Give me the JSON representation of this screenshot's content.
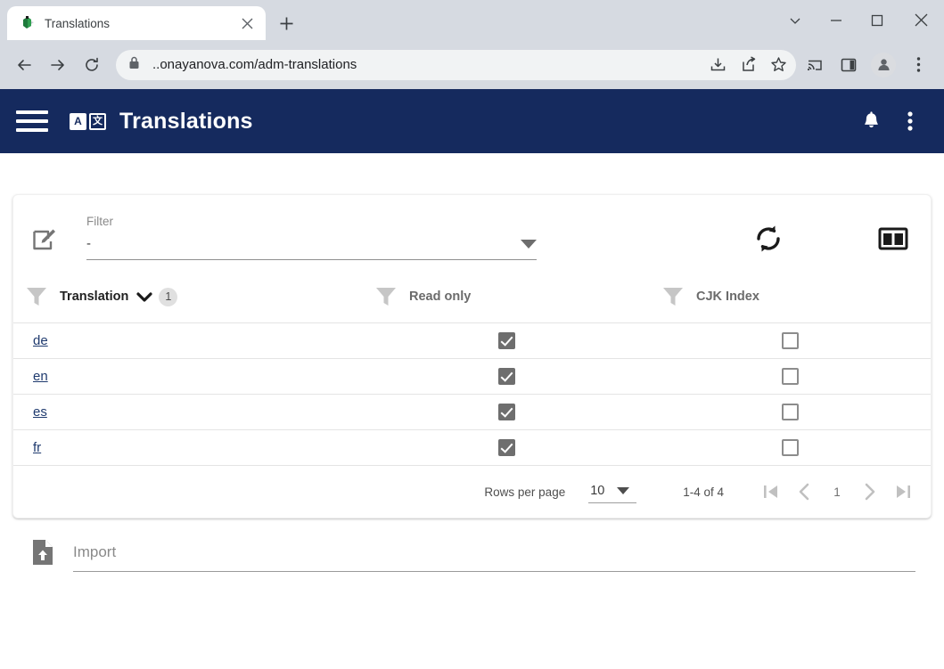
{
  "browser": {
    "tab": {
      "title": "Translations",
      "favicon_name": "site-favicon",
      "close_label": "×",
      "new_tab_label": "+"
    },
    "window_controls": {
      "tab_search": "tab-search-chevron",
      "minimize": "minimize",
      "maximize": "maximize",
      "close": "close"
    },
    "toolbar": {
      "back": "back-arrow",
      "forward": "forward-arrow",
      "reload": "reload",
      "lock": "lock-icon",
      "url": "..onayanova.com/adm-translations",
      "download": "download-icon",
      "share": "share-icon",
      "bookmark": "bookmark-star-icon",
      "cast": "cast-icon",
      "side_panel": "side-panel-icon",
      "profile": "profile-avatar",
      "menu": "browser-menu"
    }
  },
  "app_bar": {
    "menu_label": "menu",
    "logo_a": "A",
    "logo_cjk": "文",
    "title": "Translations",
    "notifications_label": "notifications",
    "overflow_label": "more-options",
    "background_color": "#152a5e"
  },
  "card": {
    "edit_icon": "edit-square-icon",
    "filter": {
      "label": "Filter",
      "value": "-",
      "placeholder": "-"
    },
    "actions": {
      "refresh": "refresh-icon",
      "columns": "columns-icon"
    },
    "table": {
      "columns": [
        {
          "label": "Translation",
          "active": true,
          "sort": "desc",
          "sort_order": "1"
        },
        {
          "label": "Read only",
          "active": false
        },
        {
          "label": "CJK Index",
          "active": false
        }
      ],
      "rows": [
        {
          "translation": "de",
          "read_only": true,
          "cjk_index": false
        },
        {
          "translation": "en",
          "read_only": true,
          "cjk_index": false
        },
        {
          "translation": "es",
          "read_only": true,
          "cjk_index": false
        },
        {
          "translation": "fr",
          "read_only": true,
          "cjk_index": false
        }
      ]
    },
    "paginator": {
      "rows_per_page_label": "Rows per page",
      "rows_per_page_value": "10",
      "range_label": "1-4 of 4",
      "page_number": "1",
      "first_label": "first-page",
      "prev_label": "previous-page",
      "next_label": "next-page",
      "last_label": "last-page"
    }
  },
  "import": {
    "icon": "file-upload-icon",
    "label": "Import"
  }
}
